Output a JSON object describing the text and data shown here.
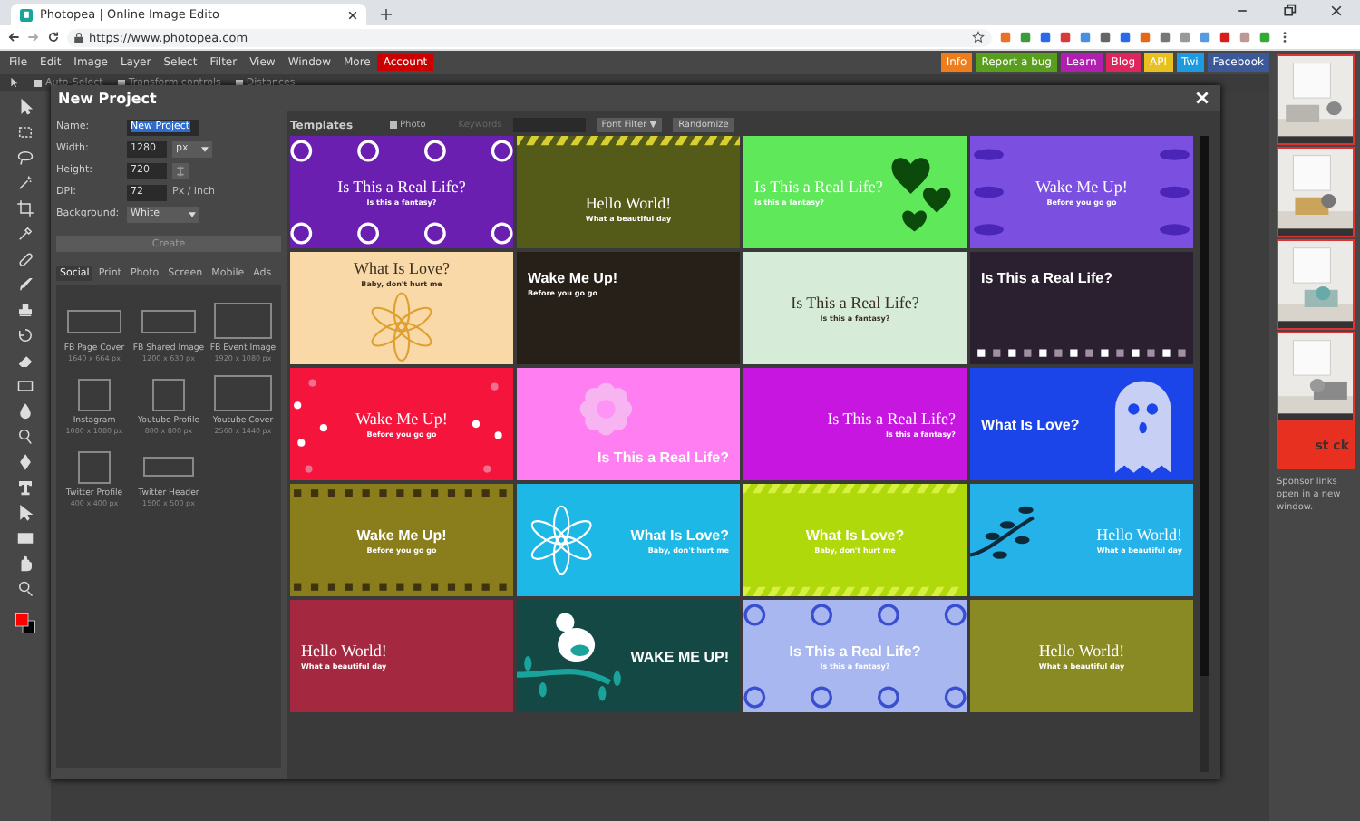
{
  "browser": {
    "tab_title": "Photopea | Online Image Edito",
    "url": "https://www.photopea.com"
  },
  "menu": [
    {
      "label": "File",
      "kind": "item"
    },
    {
      "label": "Edit",
      "kind": "item"
    },
    {
      "label": "Image",
      "kind": "item"
    },
    {
      "label": "Layer",
      "kind": "item"
    },
    {
      "label": "Select",
      "kind": "item"
    },
    {
      "label": "Filter",
      "kind": "item"
    },
    {
      "label": "View",
      "kind": "item"
    },
    {
      "label": "Window",
      "kind": "item"
    },
    {
      "label": "More",
      "kind": "item"
    },
    {
      "label": "Account",
      "kind": "account"
    }
  ],
  "links": [
    {
      "label": "Info",
      "color": "#f07d1b"
    },
    {
      "label": "Report a bug",
      "color": "#5a9e1e"
    },
    {
      "label": "Learn",
      "color": "#b01fb0"
    },
    {
      "label": "Blog",
      "color": "#e0245e"
    },
    {
      "label": "API",
      "color": "#e8c020"
    },
    {
      "label": "Twi",
      "color": "#1d9be0"
    },
    {
      "label": "Facebook",
      "color": "#3b5998"
    }
  ],
  "options_bar": [
    {
      "label": "Auto-Select",
      "checked": false
    },
    {
      "label": "Transform controls",
      "checked": false
    },
    {
      "label": "Distances",
      "checked": false
    }
  ],
  "dialog": {
    "title": "New Project",
    "fields": [
      {
        "label": "Name:",
        "value": "New Project",
        "kind": "name"
      },
      {
        "label": "Width:",
        "value": "1280",
        "unit": "px",
        "kind": "unit-select"
      },
      {
        "label": "Height:",
        "value": "720",
        "kind": "linked"
      },
      {
        "label": "DPI:",
        "value": "72",
        "unit": "Px / Inch",
        "kind": "unit-text"
      },
      {
        "label": "Background:",
        "value": "White",
        "kind": "select"
      }
    ],
    "create": "Create",
    "preset_tabs": [
      {
        "label": "Social",
        "selected": true
      },
      {
        "label": "Print",
        "selected": false
      },
      {
        "label": "Photo",
        "selected": false
      },
      {
        "label": "Screen",
        "selected": false
      },
      {
        "label": "Mobile",
        "selected": false
      },
      {
        "label": "Ads",
        "selected": false
      }
    ],
    "presets": [
      {
        "name": "FB Page Cover",
        "size": "1640 x 664 px",
        "kind": "wide"
      },
      {
        "name": "FB Shared Image",
        "size": "1200 x 630 px",
        "kind": "wide"
      },
      {
        "name": "FB Event Image",
        "size": "1920 x 1080 px",
        "kind": "large"
      },
      {
        "name": "Instagram",
        "size": "1080 x 1080 px",
        "kind": "square"
      },
      {
        "name": "Youtube Profile",
        "size": "800 x 800 px",
        "kind": "square"
      },
      {
        "name": "Youtube Cover",
        "size": "2560 x 1440 px",
        "kind": "large"
      },
      {
        "name": "Twitter Profile",
        "size": "400 x 400 px",
        "kind": "square"
      },
      {
        "name": "Twitter Header",
        "size": "1500 x 500 px",
        "kind": "banner"
      }
    ]
  },
  "templates": {
    "title": "Templates",
    "photo_label": "Photo",
    "photo_checked": false,
    "keywords_label": "Keywords",
    "font_filter": "Font Filter ▼",
    "randomize": "Randomize",
    "cards": [
      {
        "title": "Is This a Real Life?",
        "subtitle": "Is this a fantasy?",
        "color": "#6a1fb0",
        "kind": "swirl"
      },
      {
        "title": "Hello World!",
        "subtitle": "What a beautiful day",
        "color": "#545a17",
        "kind": "stripes"
      },
      {
        "title": "Is This a Real Life?",
        "subtitle": "Is this a fantasy?",
        "color": "#5ee85a",
        "kind": "hearts"
      },
      {
        "title": "Wake Me Up!",
        "subtitle": "Before you go go",
        "color": "#7b4fe0",
        "kind": "leaves"
      },
      {
        "title": "What Is Love?",
        "subtitle": "Baby, don't hurt me",
        "color": "#f9d9a8",
        "kind": "flower"
      },
      {
        "title": "Wake Me Up!",
        "subtitle": "Before you go go",
        "color": "#272018",
        "kind": "topleft"
      },
      {
        "title": "Is This a Real Life?",
        "subtitle": "Is this a fantasy?",
        "color": "#d6ecd8",
        "kind": "mint"
      },
      {
        "title": "Is This a Real Life?",
        "color": "#2a2030",
        "kind": "squares"
      },
      {
        "title": "Wake Me Up!",
        "subtitle": "Before you go go",
        "color": "#f5143c",
        "kind": "dots"
      },
      {
        "title": "Is This a Real Life?",
        "color": "#ff7ef2",
        "kind": "blossom"
      },
      {
        "title": "Is This a Real Life?",
        "subtitle": "Is this a fantasy?",
        "color": "#c616e0",
        "kind": "right"
      },
      {
        "title": "What Is Love?",
        "color": "#1b45e8",
        "kind": "ghost"
      },
      {
        "title": "Wake Me Up!",
        "subtitle": "Before you go go",
        "color": "#8a7e1c",
        "kind": "film"
      },
      {
        "title": "What Is Love?",
        "subtitle": "Baby, don't hurt me",
        "color": "#1eb8e6",
        "kind": "lily"
      },
      {
        "title": "What Is Love?",
        "subtitle": "Baby, don't hurt me",
        "color": "#b0d90c",
        "kind": "diagonal"
      },
      {
        "title": "Hello World!",
        "subtitle": "What a beautiful day",
        "color": "#25b2e8",
        "kind": "branch"
      },
      {
        "title": "Hello World!",
        "subtitle": "What a beautiful day",
        "color": "#a32840",
        "kind": "left"
      },
      {
        "title": "WAKE ME UP!",
        "color": "#134844",
        "kind": "bird"
      },
      {
        "title": "Is This a Real Life?",
        "subtitle": "Is this a fantasy?",
        "color": "#a9b7f0",
        "kind": "pale-swirl"
      },
      {
        "title": "Hello World!",
        "subtitle": "What a beautiful day",
        "color": "#8a8a24",
        "kind": "center"
      }
    ]
  },
  "ad": {
    "stock": "st ck",
    "note": "Sponsor links open in a new window."
  }
}
